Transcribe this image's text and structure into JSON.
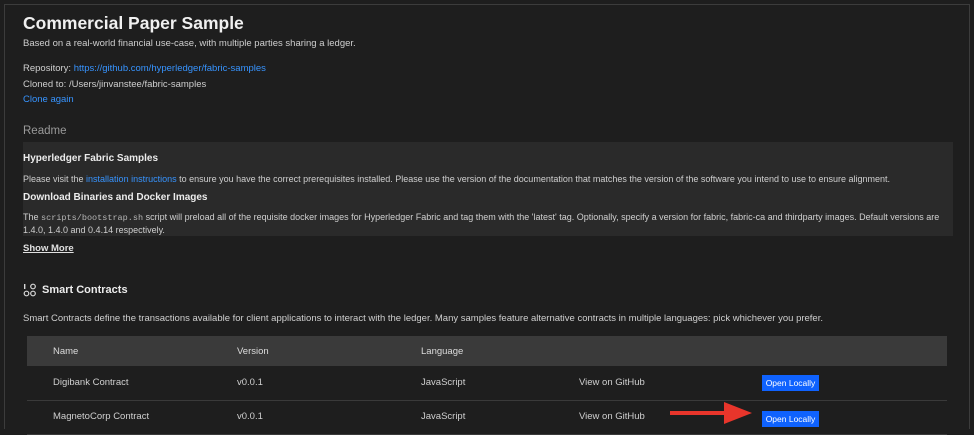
{
  "header": {
    "title": "Commercial Paper Sample",
    "subtitle": "Based on a real-world financial use-case, with multiple parties sharing a ledger."
  },
  "repo": {
    "repository_label": "Repository:",
    "repository_url": "https://github.com/hyperledger/fabric-samples",
    "cloned_label": "Cloned to:",
    "cloned_path": "/Users/jinvanstee/fabric-samples",
    "clone_again": "Clone again"
  },
  "readme": {
    "heading": "Readme",
    "h1": "Hyperledger Fabric Samples",
    "p1_before": "Please visit the",
    "p1_link": "installation instructions",
    "p1_after": "to ensure you have the correct prerequisites installed. Please use the version of the documentation that matches the version of the software you intend to use to ensure alignment.",
    "h2": "Download Binaries and Docker Images",
    "p2_before": "The",
    "p2_code": "scripts/bootstrap.sh",
    "p2_after": "script will preload all of the requisite docker images for Hyperledger Fabric and tag them with the 'latest' tag. Optionally, specify a version for fabric, fabric-ca and thirdparty images. Default versions are 1.4.0, 1.4.0 and 0.4.14 respectively.",
    "show_more": "Show More"
  },
  "smart_contracts": {
    "icon": "smart-contracts-icon",
    "title": "Smart Contracts",
    "description": "Smart Contracts define the transactions available for client applications to interact with the ledger. Many samples feature alternative contracts in multiple languages: pick whichever you prefer.",
    "columns": [
      "Name",
      "Version",
      "Language"
    ],
    "rows": [
      {
        "name": "Digibank Contract",
        "version": "v0.0.1",
        "language": "JavaScript",
        "github": "View on GitHub",
        "open": "Open Locally"
      },
      {
        "name": "MagnetoCorp Contract",
        "version": "v0.0.1",
        "language": "JavaScript",
        "github": "View on GitHub",
        "open": "Open Locally"
      }
    ]
  },
  "colors": {
    "background": "#1e1e1e",
    "link": "#3794ff",
    "button": "#0f62fe",
    "annotation_arrow": "#e8352b"
  }
}
